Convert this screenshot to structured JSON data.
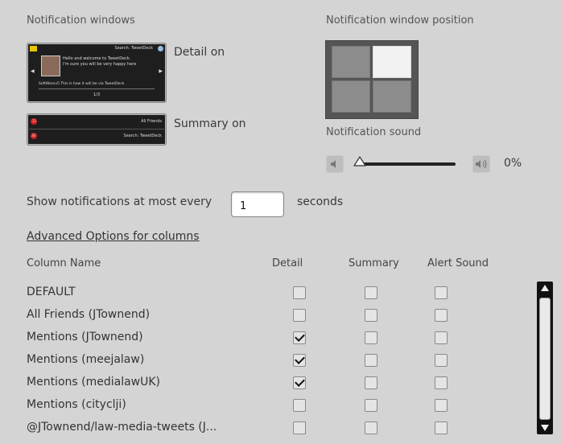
{
  "notification_windows": {
    "title": "Notification windows",
    "detail_label": "Detail on",
    "summary_label": "Summary on",
    "detail_preview": {
      "header": "Search: TweetDeck",
      "line1": "Hello and welcome to TweetDeck.",
      "line2": "I'm sure you will be very happy here",
      "footer": "SoftWarev5 This is how it will be via TweetDeck",
      "pager": "1/3"
    },
    "summary_preview": {
      "row1": "All Friends",
      "row1_count": "11",
      "row2": "Search: TweetDeck",
      "row2_count": "30"
    }
  },
  "position": {
    "title": "Notification window position",
    "selected": "top-right"
  },
  "sound": {
    "title": "Notification sound",
    "value": "0%",
    "level": 0
  },
  "frequency": {
    "prefix": "Show notifications at most every",
    "value": "1",
    "suffix": "seconds"
  },
  "advanced": {
    "link": "Advanced Options for columns",
    "headers": [
      "Column Name",
      "Detail",
      "Summary",
      "Alert Sound"
    ],
    "rows": [
      {
        "name": "DEFAULT",
        "detail": false,
        "summary": false,
        "alert": false
      },
      {
        "name": "All Friends (JTownend)",
        "detail": false,
        "summary": false,
        "alert": false
      },
      {
        "name": "Mentions (JTownend)",
        "detail": true,
        "summary": false,
        "alert": false
      },
      {
        "name": "Mentions (meejalaw)",
        "detail": true,
        "summary": false,
        "alert": false
      },
      {
        "name": "Mentions (medialawUK)",
        "detail": true,
        "summary": false,
        "alert": false
      },
      {
        "name": "Mentions (cityclji)",
        "detail": false,
        "summary": false,
        "alert": false
      },
      {
        "name": "@JTownend/law-media-tweets (J...",
        "detail": false,
        "summary": false,
        "alert": false
      }
    ]
  },
  "colors": {
    "background": "#d4d4d4",
    "selected_cell": "#f2f2f2",
    "badge_red": "#d02020"
  },
  "icons": [
    "speaker-low-icon",
    "speaker-high-icon",
    "scroll-up-arrow-icon",
    "scroll-down-arrow-icon",
    "checkmark-icon"
  ]
}
